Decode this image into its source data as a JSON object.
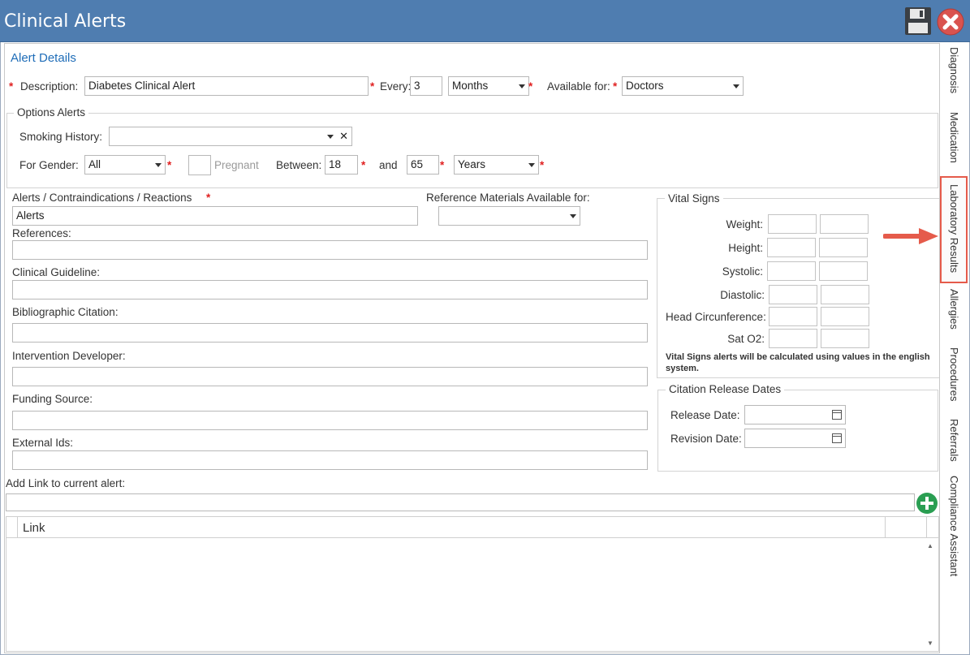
{
  "window": {
    "title": "Clinical Alerts"
  },
  "alert_details": {
    "section_title": "Alert Details",
    "description_label": "Description:",
    "description_value": "Diabetes Clinical Alert",
    "every_label": "Every:",
    "every_value": "3",
    "period_value": "Months",
    "available_for_label": "Available for:",
    "available_for_value": "Doctors",
    "required_marker": "*"
  },
  "options_alerts": {
    "legend": "Options Alerts",
    "smoking_history_label": "Smoking History:",
    "smoking_history_value": "",
    "clear_glyph": "✕",
    "gender_label": "For Gender:",
    "gender_value": "All",
    "pregnant_label": "Pregnant",
    "between_label": "Between:",
    "age_from": "18",
    "and_label": "and",
    "age_to": "65",
    "age_unit": "Years"
  },
  "fields": {
    "alerts_label": "Alerts / Contraindications / Reactions",
    "alerts_value": "Alerts",
    "reference_materials_label": "Reference Materials Available for:",
    "reference_materials_value": "",
    "references_label": "References:",
    "clinical_guideline_label": "Clinical Guideline:",
    "bibliographic_citation_label": "Bibliographic Citation:",
    "intervention_developer_label": "Intervention Developer:",
    "funding_source_label": "Funding Source:",
    "external_ids_label": "External Ids:",
    "add_link_label": "Add Link to current alert:"
  },
  "vital_signs": {
    "legend": "Vital Signs",
    "rows": [
      {
        "label": "Weight:"
      },
      {
        "label": "Height:"
      },
      {
        "label": "Systolic:"
      },
      {
        "label": "Diastolic:"
      },
      {
        "label": "Head Circunference:"
      },
      {
        "label": "Sat O2:"
      }
    ],
    "note": "Vital Signs alerts will be calculated using values in the english system."
  },
  "citation_dates": {
    "legend": "Citation Release Dates",
    "release_label": "Release Date:",
    "revision_label": "Revision Date:"
  },
  "link_grid": {
    "column_header": "Link"
  },
  "side_tabs": [
    {
      "label": "Diagnosis"
    },
    {
      "label": "Medication"
    },
    {
      "label": "Laboratory Results",
      "active": true
    },
    {
      "label": "Allergies"
    },
    {
      "label": "Procedures"
    },
    {
      "label": "Referrals"
    },
    {
      "label": "Compliance Assistant"
    }
  ],
  "icons": {
    "save": "floppy-disk-icon",
    "close": "close-circle-icon",
    "add": "plus-circle-icon",
    "calendar": "calendar-icon",
    "arrow": "pointer-arrow"
  },
  "colors": {
    "titlebar": "#4f7db0",
    "section_title": "#1f6db8",
    "required": "#e02020",
    "close_button": "#d9534f",
    "add_button": "#2a9e52",
    "highlight": "#e55b4b"
  }
}
